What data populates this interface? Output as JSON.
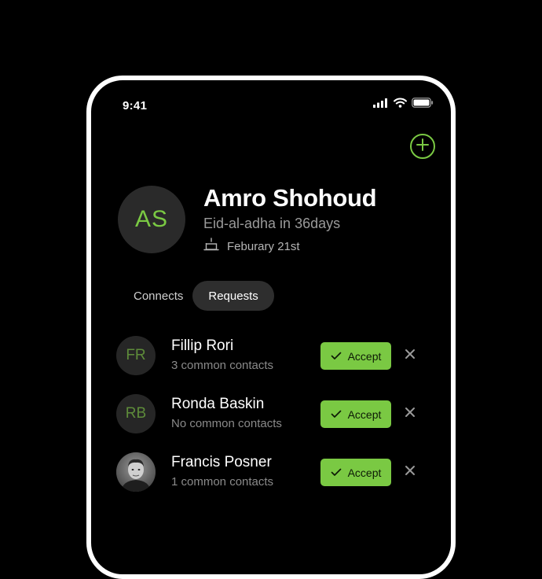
{
  "status_bar": {
    "time": "9:41",
    "icons": [
      "signal-icon",
      "wifi-icon",
      "battery-icon"
    ]
  },
  "header": {
    "add_icon": "plus-circle-icon"
  },
  "profile": {
    "initials": "AS",
    "name": "Amro Shohoud",
    "subtitle": "Eid-al-adha in 36days",
    "birthday_icon": "cake-icon",
    "birthday": "Feburary 21st"
  },
  "tabs": [
    {
      "label": "Connects",
      "active": false
    },
    {
      "label": "Requests",
      "active": true
    }
  ],
  "requests": [
    {
      "initials": "FR",
      "name": "Fillip Rori",
      "subtitle": "3 common contacts",
      "accept_label": "Accept",
      "has_photo": false
    },
    {
      "initials": "RB",
      "name": "Ronda Baskin",
      "subtitle": "No common contacts",
      "accept_label": "Accept",
      "has_photo": false
    },
    {
      "initials": "",
      "name": "Francis Posner",
      "subtitle": "1 common contacts",
      "accept_label": "Accept",
      "has_photo": true
    }
  ],
  "colors": {
    "accent": "#7ac943",
    "background": "#000000",
    "avatar_bg": "#2a2a2a",
    "muted_text": "#8a8a8a"
  }
}
